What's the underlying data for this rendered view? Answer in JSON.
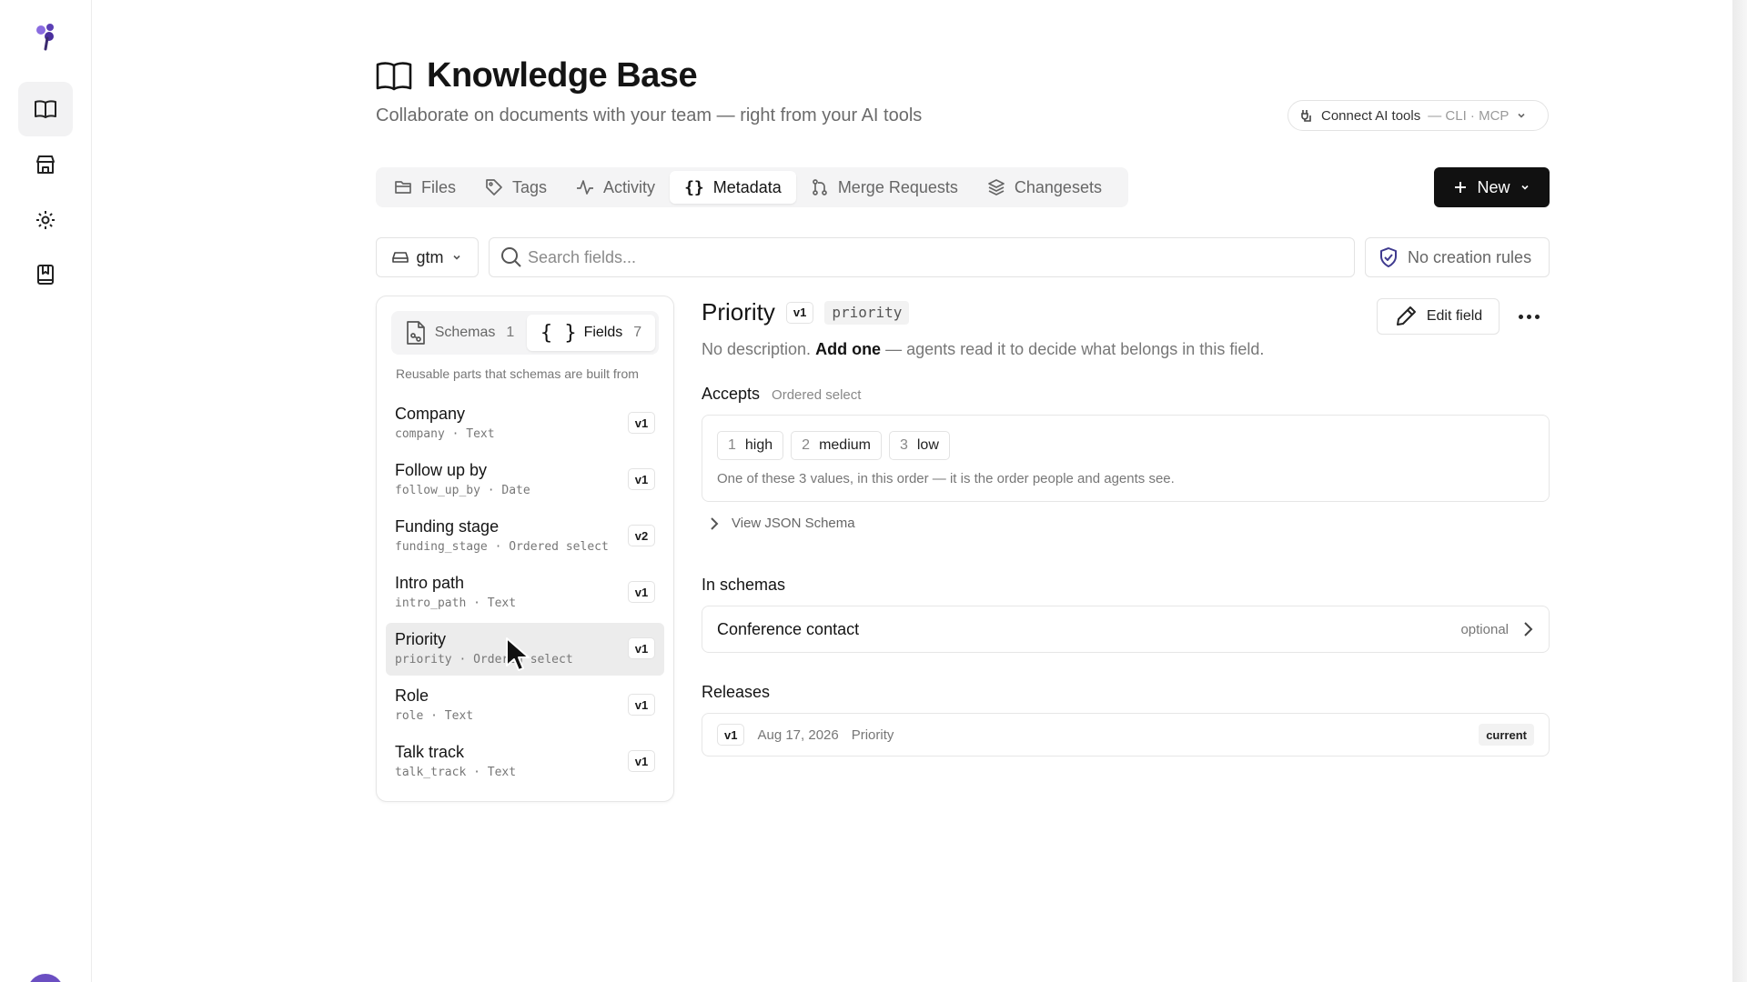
{
  "rail": {
    "items": [
      {
        "name": "knowledge-base",
        "icon": "book-icon",
        "active": true
      },
      {
        "name": "store",
        "icon": "store-icon",
        "active": false
      },
      {
        "name": "settings",
        "icon": "gear-icon",
        "active": false
      },
      {
        "name": "saved",
        "icon": "bookmark-book-icon",
        "active": false
      }
    ]
  },
  "header": {
    "title": "Knowledge Base",
    "subtitle": "Collaborate on documents with your team — right from your AI tools",
    "connect_label": "Connect AI tools",
    "connect_suffix": "— CLI · MCP"
  },
  "tabs": [
    {
      "label": "Files",
      "icon": "folder-icon"
    },
    {
      "label": "Tags",
      "icon": "tag-icon"
    },
    {
      "label": "Activity",
      "icon": "activity-icon"
    },
    {
      "label": "Metadata",
      "icon": "braces-icon",
      "active": true
    },
    {
      "label": "Merge Requests",
      "icon": "merge-icon"
    },
    {
      "label": "Changesets",
      "icon": "layers-icon"
    }
  ],
  "new_button": {
    "label": "New"
  },
  "filters": {
    "workspace": "gtm",
    "search_placeholder": "Search fields...",
    "rules_label": "No creation rules"
  },
  "left_panel": {
    "segments": [
      {
        "label": "Schemas",
        "count": "1"
      },
      {
        "label": "Fields",
        "count": "7",
        "active": true
      }
    ],
    "hint": "Reusable parts that schemas are built from",
    "fields": [
      {
        "name": "Company",
        "meta": "company · Text",
        "version": "v1"
      },
      {
        "name": "Follow up by",
        "meta": "follow_up_by · Date",
        "version": "v1"
      },
      {
        "name": "Funding stage",
        "meta": "funding_stage · Ordered select",
        "version": "v2"
      },
      {
        "name": "Intro path",
        "meta": "intro_path · Text",
        "version": "v1"
      },
      {
        "name": "Priority",
        "meta": "priority · Ordered select",
        "version": "v1",
        "selected": true
      },
      {
        "name": "Role",
        "meta": "role · Text",
        "version": "v1"
      },
      {
        "name": "Talk track",
        "meta": "talk_track · Text",
        "version": "v1"
      }
    ]
  },
  "detail": {
    "title": "Priority",
    "version": "v1",
    "key": "priority",
    "edit_label": "Edit field",
    "desc_prefix": "No description.",
    "desc_link": "Add one",
    "desc_suffix": "— agents read it to decide what belongs in this field.",
    "accepts_title": "Accepts",
    "accepts_type": "Ordered select",
    "options": [
      {
        "n": "1",
        "label": "high"
      },
      {
        "n": "2",
        "label": "medium"
      },
      {
        "n": "3",
        "label": "low"
      }
    ],
    "options_hint": "One of these 3 values, in this order — it is the order people and agents see.",
    "json_toggle": "View JSON Schema",
    "schemas_title": "In schemas",
    "schemas": [
      {
        "name": "Conference contact",
        "status": "optional"
      }
    ],
    "releases_title": "Releases",
    "releases": [
      {
        "version": "v1",
        "date": "Aug 17, 2026",
        "name": "Priority",
        "badge": "current"
      }
    ]
  },
  "colors": {
    "accent_dark": "#111111",
    "logo_purple": "#6b4fc2",
    "selected_row": "#ececec"
  }
}
